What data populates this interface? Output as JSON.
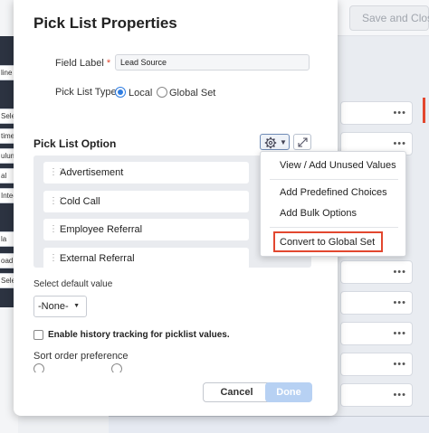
{
  "background": {
    "left_items": [
      "line",
      "Sele",
      "time",
      "ulum",
      "al",
      "Integ",
      "la",
      "oad",
      "Sele"
    ],
    "save_close_label": "Save and Close",
    "row_menu": "•••"
  },
  "modal": {
    "title": "Pick List Properties",
    "field_label": {
      "label": "Field Label",
      "required_mark": "*",
      "value": "Lead Source"
    },
    "pick_list_type": {
      "label": "Pick List Type",
      "options": [
        {
          "label": "Local",
          "selected": true
        },
        {
          "label": "Global Set",
          "selected": false
        }
      ]
    },
    "pick_list_option": {
      "title": "Pick List Option",
      "settings_icon": "gear-icon",
      "expand_icon": "expand-icon",
      "items": [
        "Advertisement",
        "Cold Call",
        "Employee Referral",
        "External Referral"
      ]
    },
    "default_value": {
      "label": "Select default value",
      "selected": "-None-"
    },
    "history_tracking": {
      "label": "Enable history tracking for picklist values.",
      "checked": false
    },
    "sort_order": {
      "label": "Sort order preference"
    },
    "buttons": {
      "cancel": "Cancel",
      "done": "Done"
    }
  },
  "menu": {
    "items": [
      "View / Add Unused Values",
      "Add Predefined Choices",
      "Add Bulk Options",
      "Convert to Global Set"
    ],
    "highlighted": "Convert to Global Set"
  },
  "colors": {
    "accent": "#2f7de1",
    "highlight_border": "#e2472f",
    "done_disabled": "#b7d1f3"
  }
}
